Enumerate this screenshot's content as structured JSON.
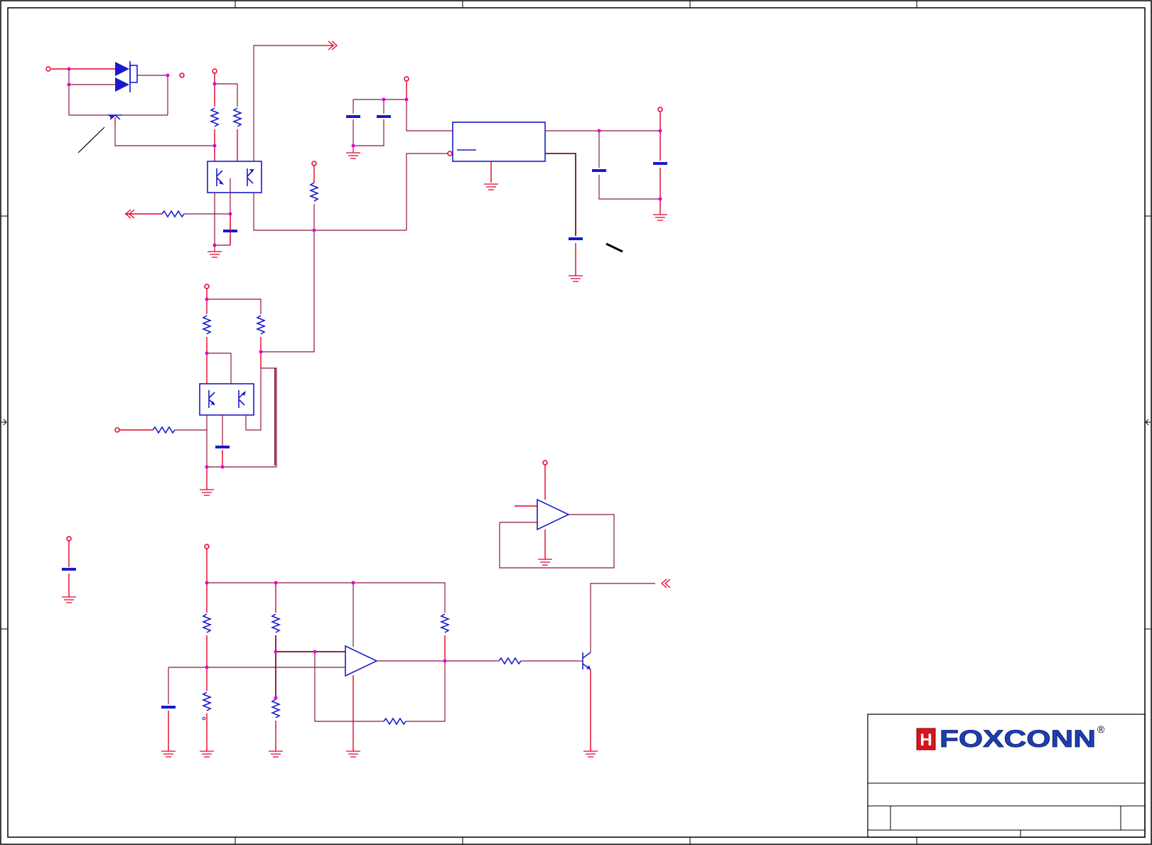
{
  "title_block": {
    "logo_text": "FOXCONN",
    "logo_mark": "H",
    "registered_mark": "®"
  },
  "colors": {
    "wire": "#8b1a3a",
    "lead": "#e4002b",
    "component": "#1a1acc",
    "junction": "#e100e1",
    "frame": "#000000",
    "logo_blue": "#1e3fb4",
    "logo_red": "#d7141e"
  }
}
